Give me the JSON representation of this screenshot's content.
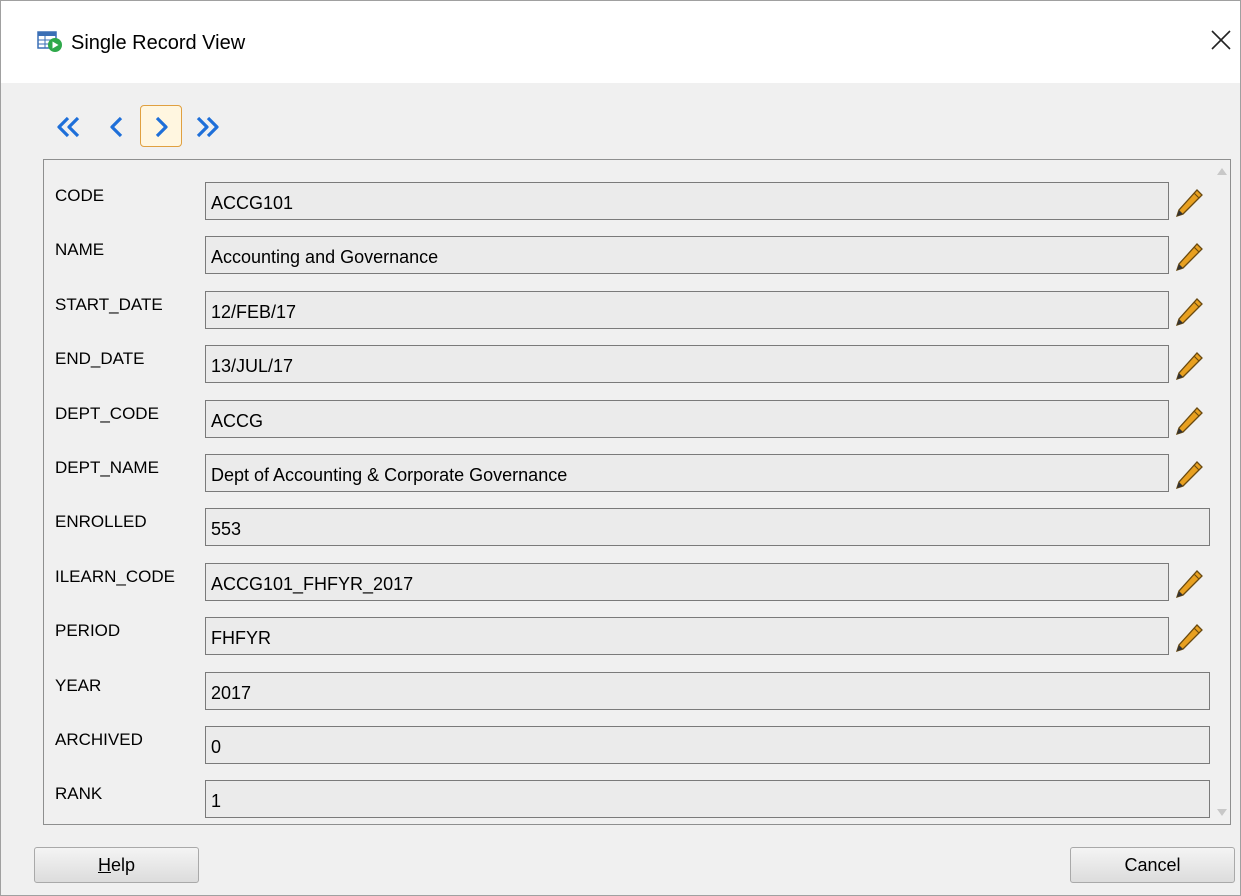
{
  "window": {
    "title": "Single Record View",
    "icon": "table-run-icon",
    "close_icon": "close-icon"
  },
  "navigation": {
    "first_icon": "double-chevron-left-icon",
    "previous_icon": "chevron-left-icon",
    "next_icon": "chevron-right-icon",
    "last_icon": "double-chevron-right-icon",
    "active": "next"
  },
  "fields": [
    {
      "label": "CODE",
      "value": "ACCG101",
      "editable": true
    },
    {
      "label": "NAME",
      "value": "Accounting and Governance",
      "editable": true
    },
    {
      "label": "START_DATE",
      "value": "12/FEB/17",
      "editable": true
    },
    {
      "label": "END_DATE",
      "value": "13/JUL/17",
      "editable": true
    },
    {
      "label": "DEPT_CODE",
      "value": "ACCG",
      "editable": true
    },
    {
      "label": "DEPT_NAME",
      "value": "Dept of Accounting & Corporate Governance",
      "editable": true
    },
    {
      "label": "ENROLLED",
      "value": "553",
      "editable": false
    },
    {
      "label": "ILEARN_CODE",
      "value": "ACCG101_FHFYR_2017",
      "editable": true
    },
    {
      "label": "PERIOD",
      "value": "FHFYR",
      "editable": true
    },
    {
      "label": "YEAR",
      "value": "2017",
      "editable": false
    },
    {
      "label": "ARCHIVED",
      "value": "0",
      "editable": false
    },
    {
      "label": "RANK",
      "value": "1",
      "editable": false
    }
  ],
  "buttons": {
    "help_mnemonic": "H",
    "help_rest": "elp",
    "cancel": "Cancel"
  },
  "colors": {
    "nav_blue": "#1e6fd9",
    "pencil": "#e8a020"
  }
}
